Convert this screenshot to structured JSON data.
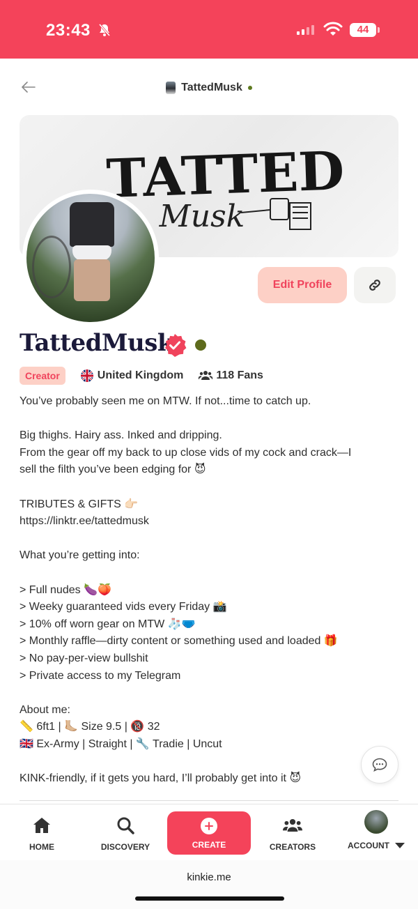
{
  "status_bar": {
    "time": "23:43",
    "battery": "44"
  },
  "header": {
    "username": "TattedMusk"
  },
  "banner": {
    "title_line1": "TATTED",
    "title_line2": "Musk"
  },
  "buttons": {
    "edit_profile": "Edit Profile"
  },
  "profile": {
    "name": "TattedMusk",
    "badge": "Creator",
    "location": "United Kingdom",
    "fans": "118 Fans"
  },
  "bio": {
    "lines": [
      "You’ve probably seen me on MTW. If not...time to catch up.",
      "",
      "Big thighs. Hairy ass. Inked and dripping.",
      "From the gear off my back to up close vids of my cock and crack—I",
      "sell the filth you’ve been edging for 😈",
      "",
      "TRIBUTES & GIFTS 👉🏻",
      "https://linktr.ee/tattedmusk",
      "",
      "What you’re getting into:",
      "",
      "> Full nudes 🍆🍑",
      "> Weeky guaranteed vids every Friday 📸",
      "> 10% off worn gear on MTW 🧦🩲",
      "> Monthly raffle—dirty content or something used and loaded 🎁",
      "> No pay-per-view bullshit",
      "> Private access to my Telegram",
      "",
      "About me:",
      "📏 6ft1 | 🦶🏼 Size 9.5 | 🔞 32",
      "🇬🇧 Ex-Army | Straight | 🔧 Tradie | Uncut",
      "",
      "KINK-friendly, if it gets you hard, I’ll probably get into it 😈"
    ]
  },
  "nav": {
    "home": "HOME",
    "discovery": "DISCOVERY",
    "create": "CREATE",
    "creators": "CREATORS",
    "account": "ACCOUNT"
  },
  "browser": {
    "url": "kinkie.me"
  },
  "colors": {
    "brand": "#f4435a",
    "badge_bg": "#fdd0c6",
    "name": "#1b1a3a",
    "online": "#5e6b1c"
  }
}
